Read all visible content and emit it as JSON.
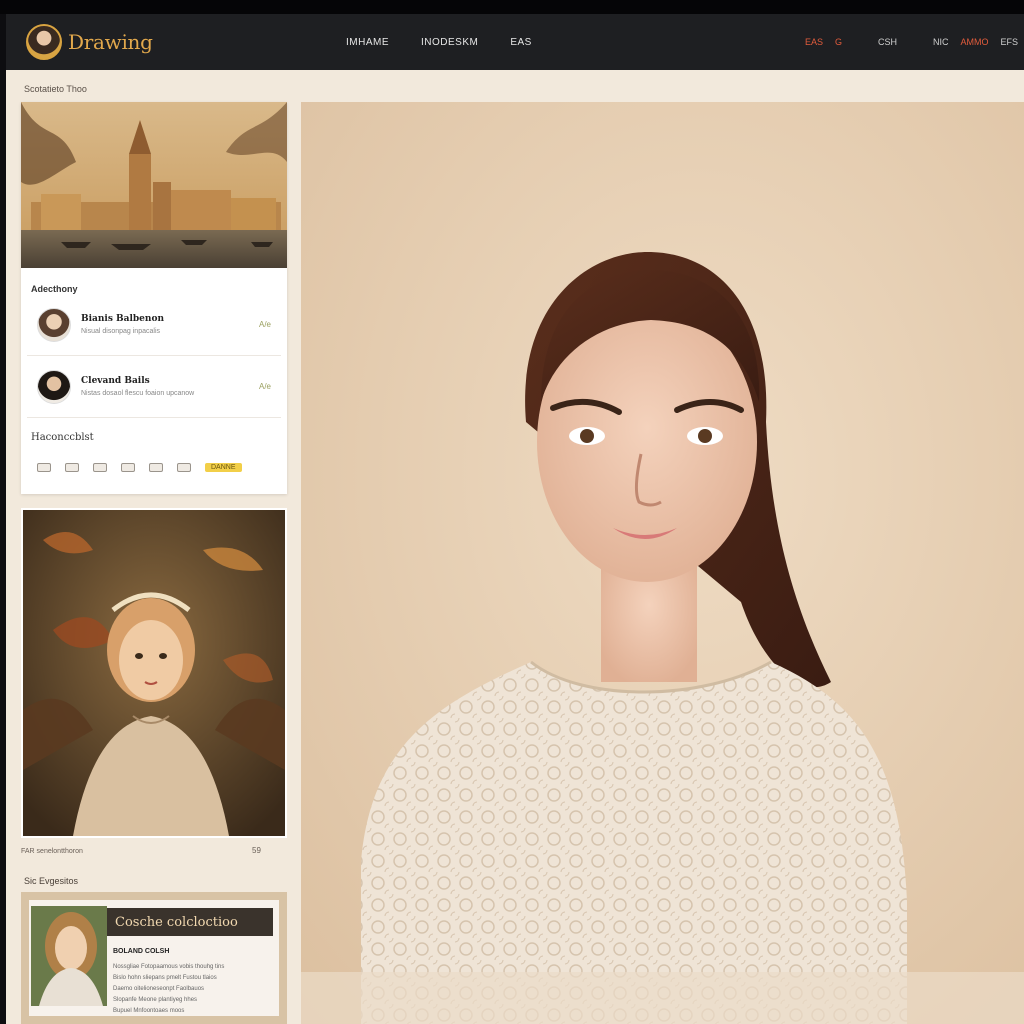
{
  "app": {
    "logo_text": "Drawing"
  },
  "nav": {
    "links": [
      "IMHAME",
      "INODESKM",
      "EAS"
    ],
    "right_items": [
      "EAS",
      "G",
      "CSH",
      "NIC",
      "AMMO",
      "EFS"
    ]
  },
  "page": {
    "label": "Scotatieto Thoo"
  },
  "sidebar": {
    "heading": "Adecthony",
    "users": [
      {
        "name": "Bianis Balbenon",
        "subtitle": "Nisual disonpag inpacalis",
        "action": "A/e"
      },
      {
        "name": "Clevand Bails",
        "subtitle": "Nistas dosaol flescu foaion upcanow",
        "action": "A/e"
      }
    ],
    "section": "Haconccblst",
    "toolbar_button": "DANNE"
  },
  "painting": {
    "caption": "FAR senelontthoron",
    "meta": "59"
  },
  "promo": {
    "section_label": "Sic Evgesitos",
    "title": "Cosche colcloctioo",
    "subtitle": "BOLAND COLSH",
    "lines": [
      "Nossgliae Fotopaamous vobis thouhg tins",
      "Bislo hohn sliepans pmelt Fustou tlaios",
      "Daemo oitelioneseonpt Faolbauos",
      "Slopanfe Meone plantiyeg hhes",
      "Bupuel Mnfoontoaes moos"
    ]
  },
  "colors": {
    "accent": "#e2a84c",
    "navbar": "#1e1f22",
    "page_bg": "#f2e9dc",
    "nav_highlight": "#e25c3c",
    "button_yellow": "#f2cf48"
  },
  "icons": [
    "user-avatar-icon",
    "image-icon",
    "share-icon",
    "heart-icon",
    "comment-icon",
    "bookmark-icon",
    "grid-icon"
  ]
}
